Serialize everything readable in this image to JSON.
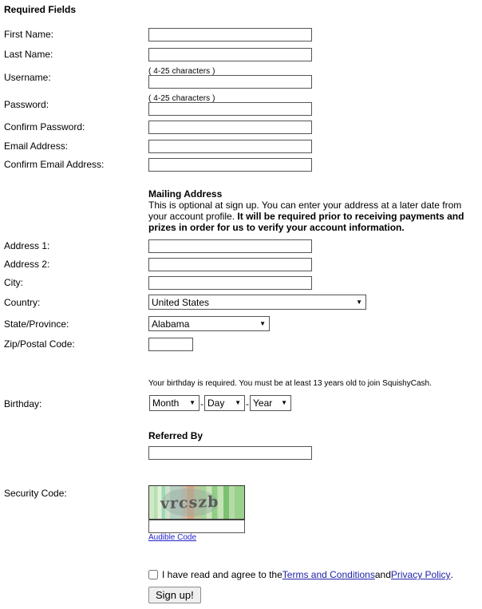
{
  "form": {
    "required_section_title": "Required Fields",
    "fields": [
      {
        "label": "First Name:",
        "value": "",
        "hint": ""
      },
      {
        "label": "Last Name:",
        "value": "",
        "hint": ""
      },
      {
        "label": "Username:",
        "value": "",
        "hint": "( 4-25 characters )"
      },
      {
        "label": "Password:",
        "value": "",
        "hint": "( 4-25 characters )"
      },
      {
        "label": "Confirm Password:",
        "value": "",
        "hint": ""
      },
      {
        "label": "Email Address:",
        "value": "",
        "hint": ""
      },
      {
        "label": "Confirm Email Address:",
        "value": "",
        "hint": ""
      }
    ],
    "mailing": {
      "title": "Mailing Address",
      "text_part1": "This is optional at sign up. You can enter your address at a later date from your account profile. ",
      "text_bold": "It will be required prior to receiving payments and prizes in order for us to verify your account information.",
      "address1_label": "Address 1:",
      "address1_value": "",
      "address2_label": "Address 2:",
      "address2_value": "",
      "city_label": "City:",
      "city_value": "",
      "country_label": "Country:",
      "country_value": "United States",
      "state_label": "State/Province:",
      "state_value": "Alabama",
      "zip_label": "Zip/Postal Code:",
      "zip_value": ""
    },
    "birthday": {
      "note": "Your birthday is required. You must be at least 13 years old to join SquishyCash.",
      "label": "Birthday:",
      "month_value": "Month",
      "day_value": "Day",
      "year_value": "Year",
      "separator": "-"
    },
    "referred": {
      "title": "Referred By",
      "value": ""
    },
    "security": {
      "label": "Security Code:",
      "captcha_text": "vrcszb",
      "input_value": "",
      "audible_link": "Audible Code"
    },
    "terms": {
      "checked": false,
      "text_before": "I have read and agree to the ",
      "link_terms": "Terms and Conditions",
      "text_between": " and ",
      "link_privacy": "Privacy Policy",
      "text_after": "."
    },
    "submit_label": "Sign up!"
  },
  "colors": {
    "link": "#2222aa",
    "border": "#555555",
    "button_bg": "#efefef"
  }
}
